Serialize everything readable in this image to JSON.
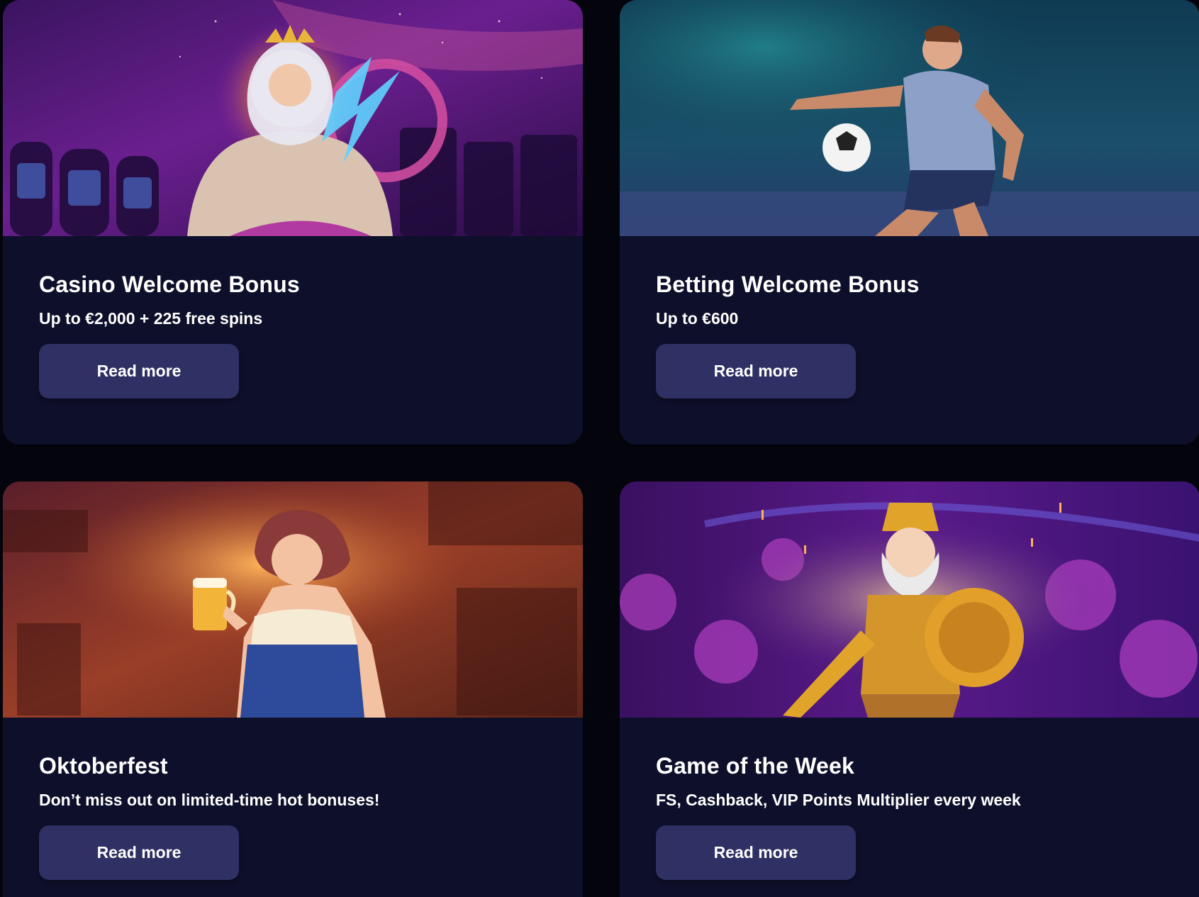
{
  "cards": [
    {
      "title": "Casino Welcome Bonus",
      "subtitle": "Up to €2,000 + 225 free spins",
      "button_label": "Read more",
      "image": "zeus-casino-art"
    },
    {
      "title": "Betting Welcome Bonus",
      "subtitle": "Up to €600",
      "button_label": "Read more",
      "image": "football-player-art"
    },
    {
      "title": "Oktoberfest",
      "subtitle": "Don’t miss out on limited-time hot bonuses!",
      "button_label": "Read more",
      "image": "oktoberfest-woman-art"
    },
    {
      "title": "Game of the Week",
      "subtitle": "FS, Cashback, VIP Points Multiplier every week",
      "button_label": "Read more",
      "image": "golden-warrior-art"
    }
  ],
  "colors": {
    "page_bg": "#04040d",
    "card_bg": "#0e0f2a",
    "button_bg": "#2f3063",
    "text": "#ffffff"
  }
}
